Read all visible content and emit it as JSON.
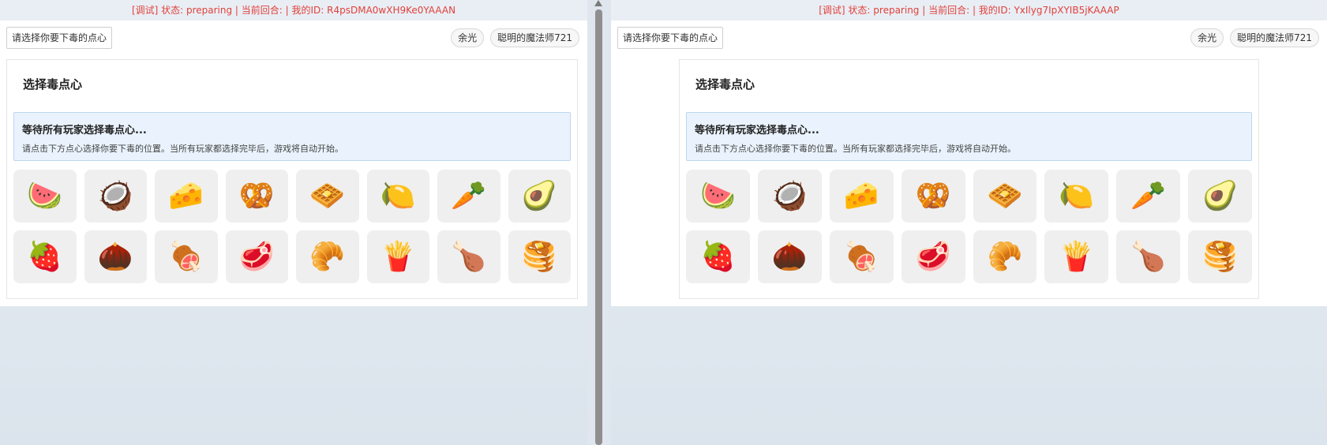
{
  "snacks": [
    {
      "name": "watermelon",
      "glyph": "🍉"
    },
    {
      "name": "coconut",
      "glyph": "🥥"
    },
    {
      "name": "cheese",
      "glyph": "🧀"
    },
    {
      "name": "pretzel",
      "glyph": "🥨"
    },
    {
      "name": "waffle",
      "glyph": "🧇"
    },
    {
      "name": "lemon",
      "glyph": "🍋"
    },
    {
      "name": "carrot",
      "glyph": "🥕"
    },
    {
      "name": "avocado",
      "glyph": "🥑"
    },
    {
      "name": "strawberry",
      "glyph": "🍓"
    },
    {
      "name": "chestnut",
      "glyph": "🌰"
    },
    {
      "name": "meat-on-bone",
      "glyph": "🍖"
    },
    {
      "name": "cut-of-meat",
      "glyph": "🥩"
    },
    {
      "name": "croissant",
      "glyph": "🥐"
    },
    {
      "name": "french-fries",
      "glyph": "🍟"
    },
    {
      "name": "poultry-leg",
      "glyph": "🍗"
    },
    {
      "name": "pancakes",
      "glyph": "🥞"
    }
  ],
  "left": {
    "debug": "[调试] 状态: preparing | 当前回合: | 我的ID: R4psDMA0wXH9Ke0YAAAN",
    "select_hint": "请选择你要下毒的点心",
    "players": [
      "余光",
      "聪明的魔法师721"
    ],
    "card_title": "选择毒点心",
    "notice_title": "等待所有玩家选择毒点心...",
    "notice_desc": "请点击下方点心选择你要下毒的位置。当所有玩家都选择完毕后，游戏将自动开始。"
  },
  "right": {
    "debug": "[调试] 状态: preparing | 当前回合: | 我的ID: YxIlyg7IpXYIB5jKAAAP",
    "select_hint": "请选择你要下毒的点心",
    "players": [
      "余光",
      "聪明的魔法师721"
    ],
    "card_title": "选择毒点心",
    "notice_title": "等待所有玩家选择毒点心...",
    "notice_desc": "请点击下方点心选择你要下毒的位置。当所有玩家都选择完毕后，游戏将自动开始。"
  },
  "colors": {
    "debug_text": "#e0413a",
    "notice_bg": "#eaf3fd",
    "tile_bg": "#efefef"
  }
}
